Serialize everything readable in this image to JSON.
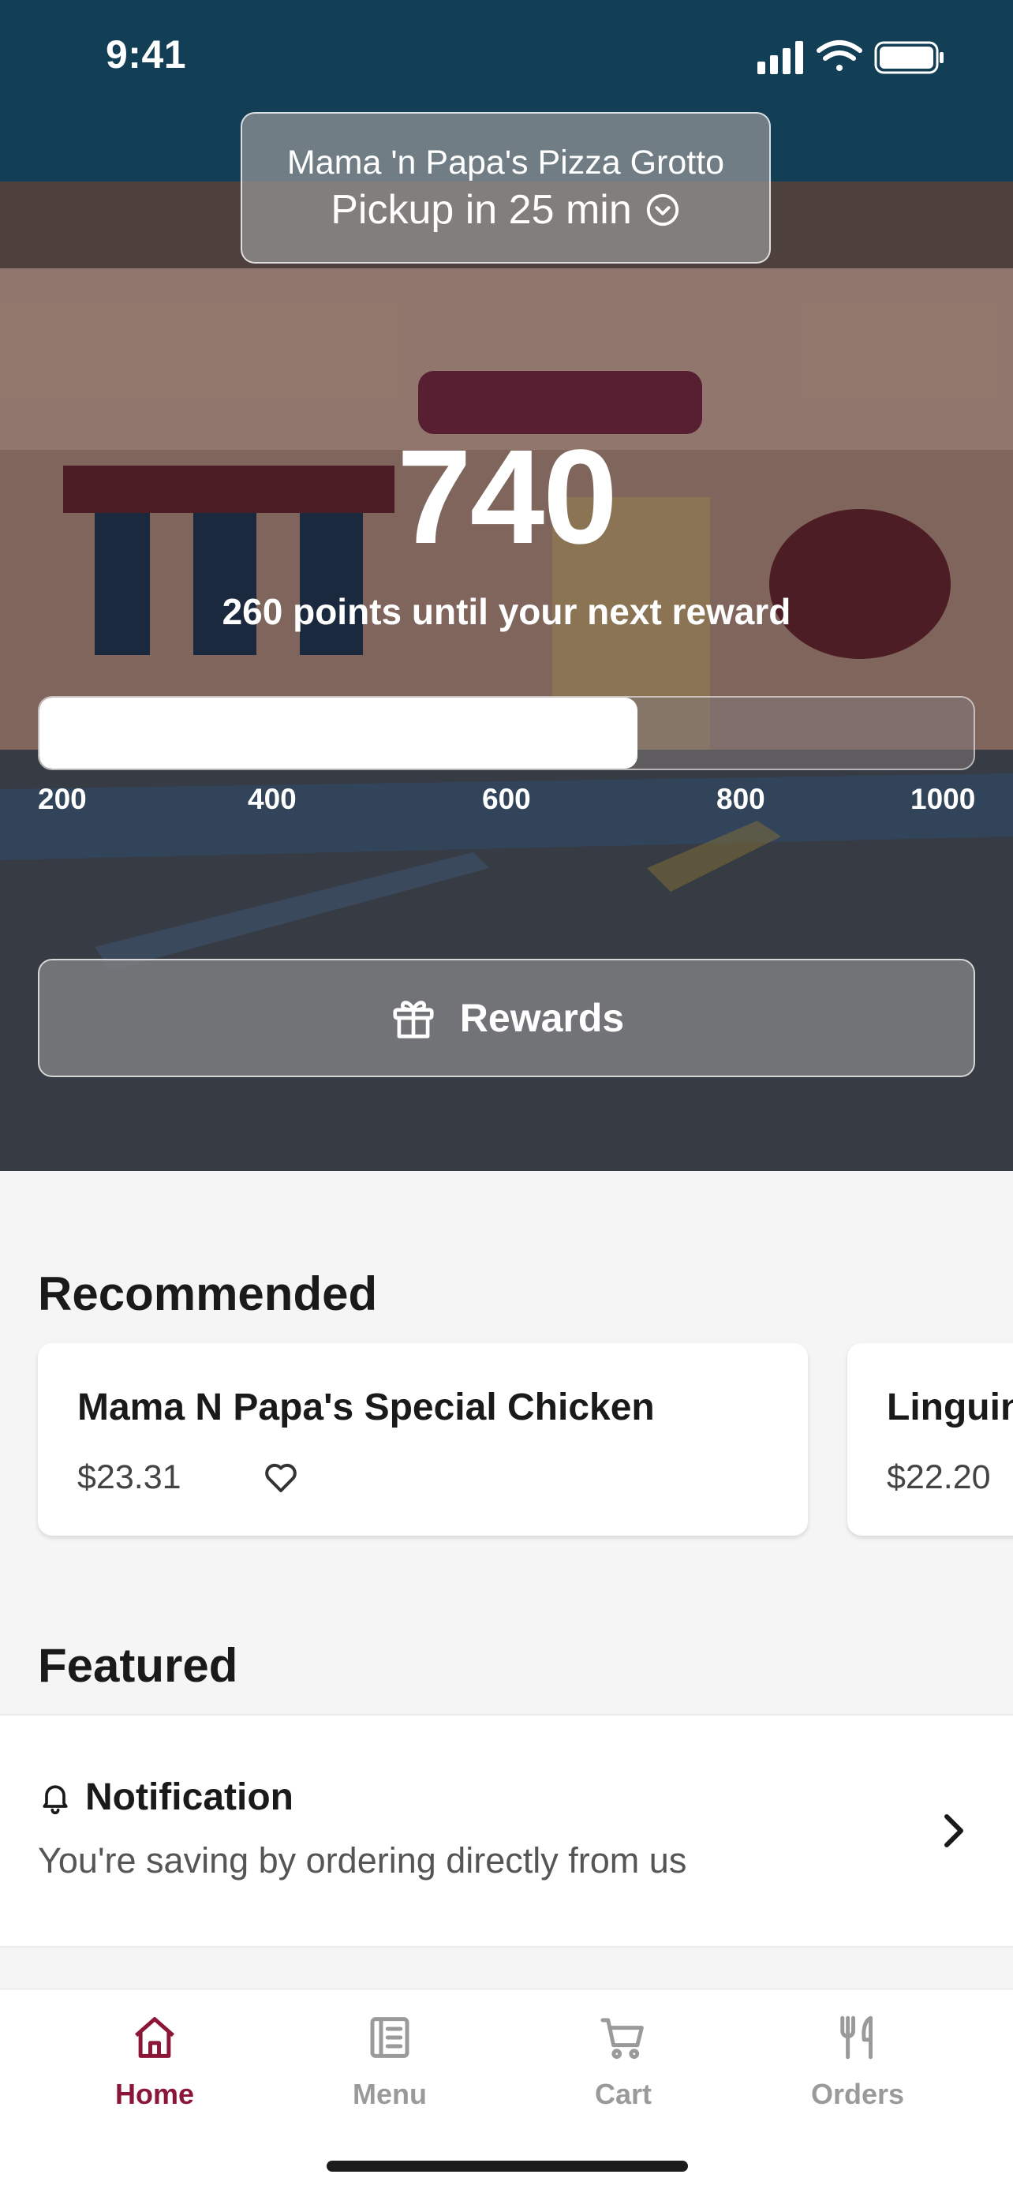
{
  "status_bar": {
    "time": "9:41"
  },
  "store": {
    "name": "Mama 'n Papa's Pizza Grotto",
    "pickup": "Pickup in 25 min"
  },
  "loyalty": {
    "points": "740",
    "caption": "260 points until your next reward",
    "progress_fraction": 0.64,
    "ticks": [
      "200",
      "400",
      "600",
      "800",
      "1000"
    ]
  },
  "rewards_button": {
    "label": "Rewards",
    "icon": "gift-icon"
  },
  "recommended": {
    "title": "Recommended",
    "items": [
      {
        "name": "Mama N Papa's Special Chicken",
        "price": "$23.31"
      },
      {
        "name": "Linguin",
        "price": "$22.20"
      }
    ]
  },
  "featured": {
    "title": "Featured",
    "notification": {
      "title": "Notification",
      "subtitle": "You're saving by ordering directly from us"
    }
  },
  "tabs": [
    {
      "label": "Home",
      "icon": "home-icon",
      "active": true
    },
    {
      "label": "Menu",
      "icon": "menu-icon",
      "active": false
    },
    {
      "label": "Cart",
      "icon": "cart-icon",
      "active": false
    },
    {
      "label": "Orders",
      "icon": "fork-knife-icon",
      "active": false
    }
  ],
  "colors": {
    "accent": "#8c1637",
    "inactive_tab": "#9a9a9a"
  }
}
